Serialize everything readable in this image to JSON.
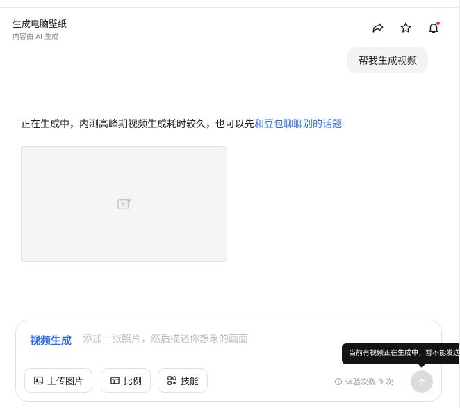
{
  "header": {
    "title": "生成电脑壁纸",
    "subtitle": "内容由 AI 生成",
    "icons": {
      "share": "share-icon",
      "favorite": "star-icon",
      "notifications": "bell-icon"
    },
    "notification_dot_color": "#f23c3c"
  },
  "messages": {
    "user": "帮我生成视频",
    "assistant_text": "正在生成中，内测高峰期视频生成耗时较久，也可以先",
    "assistant_link": "和豆包聊聊别的话题"
  },
  "video_placeholder": {
    "icon": "video-add-icon"
  },
  "composer": {
    "mode_label": "视频生成",
    "placeholder": "添加一张照片，然后描述你想象的画面",
    "value": "",
    "chips": {
      "upload": "上传图片",
      "ratio": "比例",
      "skills": "技能"
    },
    "quota_text": "体验次数 9 次",
    "tooltip": "当前有视频正在生成中，暂不能发送"
  },
  "colors": {
    "accent": "#2f6bf0",
    "bubble_bg": "#f3f3f4",
    "send_disabled": "#dcdcdc"
  }
}
